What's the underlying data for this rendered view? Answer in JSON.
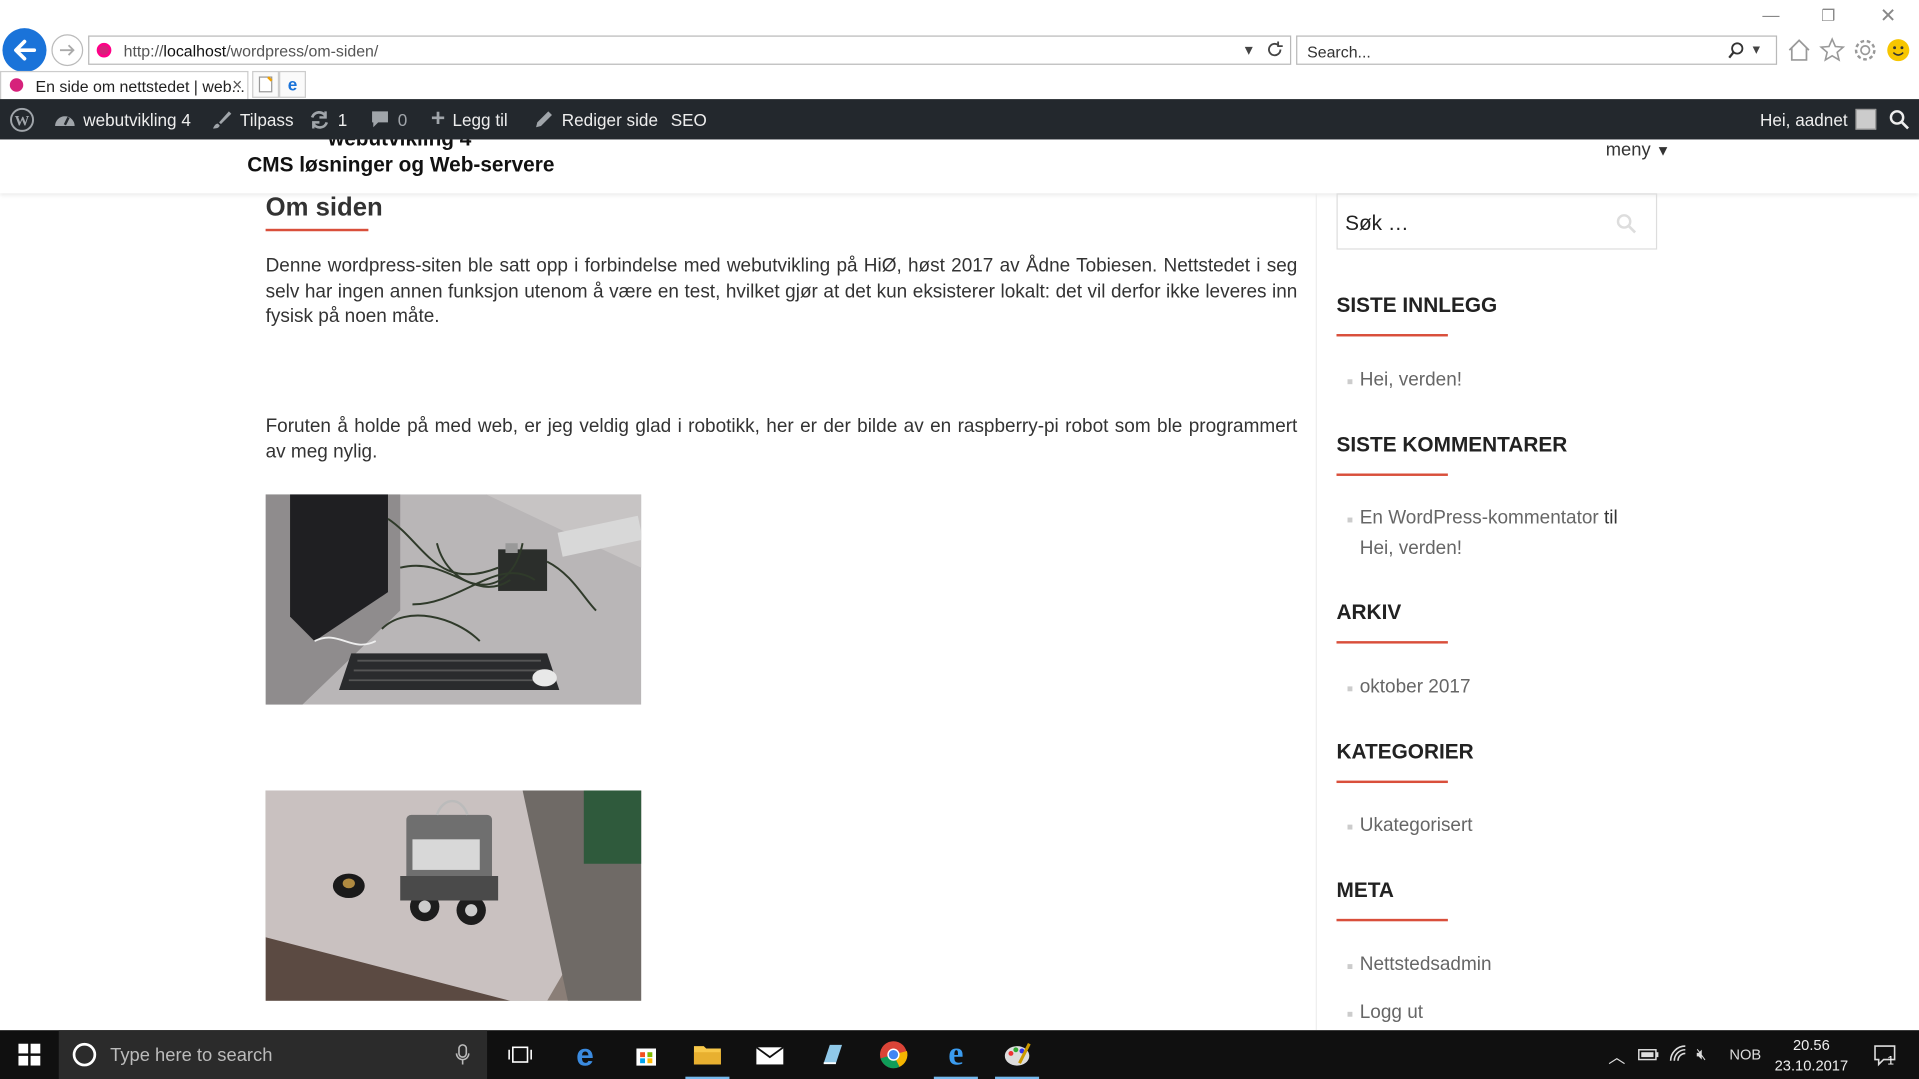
{
  "browser": {
    "url_prefix": "http://",
    "url_host": "localhost",
    "url_path": "/wordpress/om-siden/",
    "search_placeholder": "Search...",
    "tab_title": "En side om nettstedet | web...",
    "tab_close": "×"
  },
  "admin_bar": {
    "site_name": "webutvikling 4",
    "customize": "Tilpass",
    "updates_count": "1",
    "comments_count": "0",
    "add_new": "Legg til",
    "edit_page": "Rediger side",
    "seo": "SEO",
    "greeting": "Hei, aadnet"
  },
  "site": {
    "title": "webutvikling 4",
    "tagline": "CMS løsninger og Web-servere",
    "menu_label": "meny"
  },
  "page": {
    "title": "Om siden",
    "paragraph1": "Denne wordpress-siten ble satt opp i forbindelse med webutvikling på HiØ, høst 2017 av Ådne Tobiesen. Nettstedet i seg selv har ingen annen funksjon utenom å være en test, hvilket gjør at det kun eksisterer lokalt: det vil derfor ikke leveres inn fysisk på noen måte.",
    "paragraph2": "Foruten å holde på med web, er jeg veldig glad i robotikk, her er der bilde av en raspberry-pi robot som ble programmert av meg nylig."
  },
  "sidebar": {
    "search_placeholder": "Søk …",
    "recent_posts_title": "SISTE INNLEGG",
    "recent_posts": [
      "Hei, verden!"
    ],
    "recent_comments_title": "SISTE KOMMENTARER",
    "comment_author": "En WordPress-kommentator",
    "comment_connector": "til",
    "comment_post": "Hei, verden!",
    "archive_title": "ARKIV",
    "archive": [
      "oktober 2017"
    ],
    "categories_title": "KATEGORIER",
    "categories": [
      "Ukategorisert"
    ],
    "meta_title": "META",
    "meta": [
      "Nettstedsadmin",
      "Logg ut"
    ]
  },
  "taskbar": {
    "search_placeholder": "Type here to search",
    "language": "NOB",
    "time": "20.56",
    "date": "23.10.2017",
    "notification_count": "1"
  },
  "colors": {
    "accent_underline": "#d94f3b",
    "admin_bar": "#23282d",
    "ie_blue": "#1a73d9",
    "taskbar": "#101010"
  }
}
